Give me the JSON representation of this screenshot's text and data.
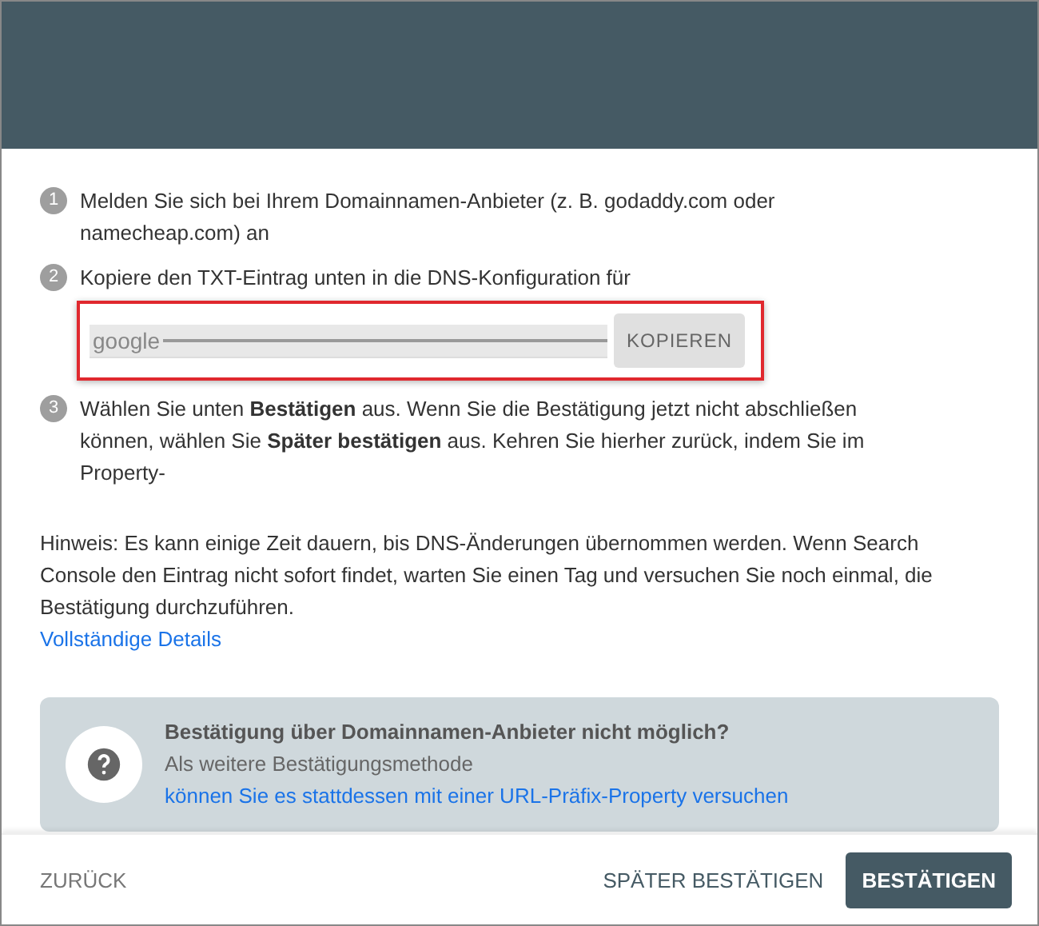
{
  "steps": [
    {
      "number": "1",
      "text": "Melden Sie sich bei Ihrem Domainnamen-Anbieter (z. B. godaddy.com oder namecheap.com) an"
    },
    {
      "number": "2",
      "text": "Kopiere den TXT-Eintrag unten in die DNS-Konfiguration für",
      "record": {
        "value": "google",
        "button": "KOPIEREN",
        "highlighted": true
      }
    },
    {
      "number": "3",
      "text": "Wählen Sie unten **Bestätigen** aus. Wenn Sie die Bestätigung jetzt nicht abschließen können, wählen Sie **Später bestätigen** aus. Kehren Sie hierher zurück, indem Sie im Property-"
    }
  ],
  "hint": "Hinweis: Es kann einige Zeit dauern, bis DNS-Änderungen übernommen werden. Wenn Search Console den Eintrag nicht sofort findet, warten Sie einen Tag und versuchen Sie noch einmal, die Bestätigung durchzuführen.",
  "details_link": "Vollständige Details",
  "info": {
    "title": "Bestätigung über Domainnamen-Anbieter nicht möglich?",
    "text": "Als weitere Bestätigungsmethode",
    "link": "können Sie es stattdessen mit einer URL-Präfix-Property versuchen"
  },
  "footer": {
    "back": "ZURÜCK",
    "later": "SPÄTER BESTÄTIGEN",
    "confirm": "BESTÄTIGEN"
  }
}
